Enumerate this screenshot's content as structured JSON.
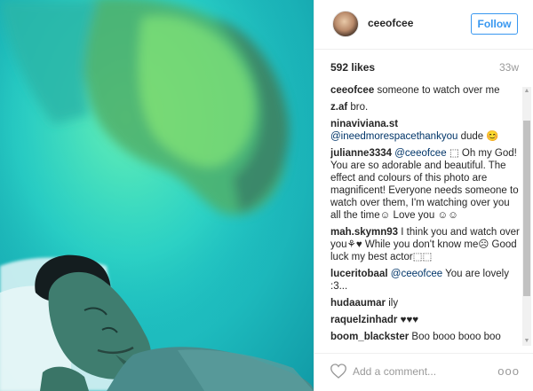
{
  "post": {
    "username": "ceeofcee",
    "follow_label": "Follow",
    "likes": "592 likes",
    "time_ago": "33w"
  },
  "comments": [
    {
      "user": "ceeofcee",
      "mention": "",
      "text": "someone to watch over me"
    },
    {
      "user": "z.af",
      "mention": "",
      "text": "bro."
    },
    {
      "user": "ninaviviana.st",
      "mention": "@ineedmorespacethankyou",
      "text": "dude 😊"
    },
    {
      "user": "julianne3334",
      "mention": "@ceeofcee",
      "text": "⬚ Oh my God! You are so adorable and beautiful. The effect and colours of this photo are magnificent! Everyone needs someone to watch over them, I'm watching over you all the time☺ Love you ☺☺"
    },
    {
      "user": "mah.skymn93",
      "mention": "",
      "text": "I think you and watch over you⚘♥ While you don't know me☹ Good luck my best actor⬚⬚"
    },
    {
      "user": "luceritobaal",
      "mention": "@ceeofcee",
      "text": "You are lovely :3..."
    },
    {
      "user": "hudaaumar",
      "mention": "",
      "text": "ily"
    },
    {
      "user": "raquelzinhadr",
      "mention": "",
      "text": "♥♥♥"
    },
    {
      "user": "boom_blackster",
      "mention": "",
      "text": "Boo booo booo boo"
    }
  ],
  "footer": {
    "comment_placeholder": "Add a comment...",
    "more_label": "ooo"
  },
  "scrollbar": {
    "up_arrow": "▲",
    "down_arrow": "▼"
  },
  "icons": {
    "heart": "heart-icon",
    "more": "more-options-icon"
  },
  "colors": {
    "link": "#3897f0",
    "mention": "#003569",
    "photo_tint": "#22c7c6"
  }
}
